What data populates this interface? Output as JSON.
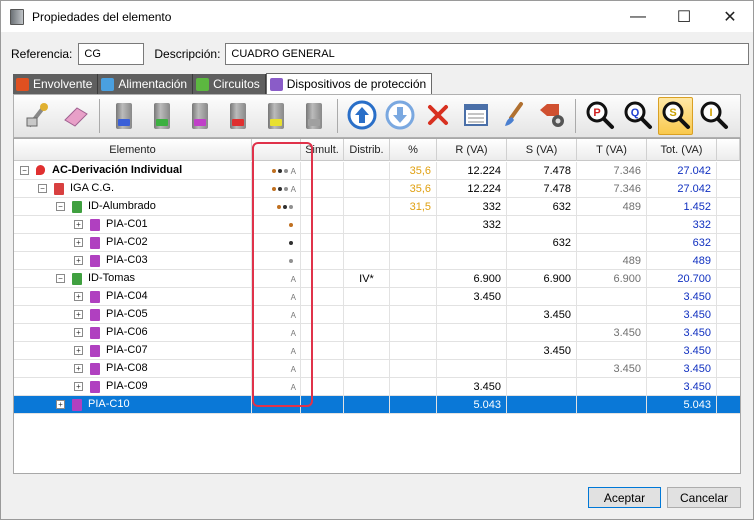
{
  "window": {
    "title": "Propiedades del elemento",
    "minimize_glyph": "—",
    "maximize_glyph": "☐",
    "close_glyph": "✕"
  },
  "fields": {
    "referencia_label": "Referencia:",
    "referencia_value": "CG",
    "descripcion_label": "Descripción:",
    "descripcion_value": "CUADRO GENERAL"
  },
  "tabs": [
    {
      "label": "Envolvente",
      "icon": "envelope-icon",
      "color": "#e05020"
    },
    {
      "label": "Alimentación",
      "icon": "feed-icon",
      "color": "#4aa0e0"
    },
    {
      "label": "Circuitos",
      "icon": "circuits-icon",
      "color": "#5cb840"
    },
    {
      "label": "Dispositivos de protección",
      "icon": "protection-devices-icon",
      "color": "#8a5cc8",
      "active": true
    }
  ],
  "toolbar_icons": [
    "wizard-icon",
    "eraser-icon",
    "device-blue-icon",
    "device-green-icon",
    "device-purple-icon",
    "device-red-icon",
    "device-yellow-icon",
    "device-grey-icon",
    "move-up-icon",
    "move-down-icon",
    "delete-icon",
    "table-view-icon",
    "brush-icon",
    "price-tag-settings-icon",
    "search-p-icon",
    "search-q-icon",
    "search-s-icon",
    "search-i-icon"
  ],
  "columns": [
    "Elemento",
    "Simult.",
    "Distrib.",
    "%",
    "R (VA)",
    "S (VA)",
    "T (VA)",
    "Tot. (VA)"
  ],
  "colors": {
    "pct": "#e0a010",
    "tot": "#1030c0",
    "t": "#707070",
    "selection": "#0a78d7",
    "highlight_box": "#e0324a"
  },
  "rows": [
    {
      "level": 0,
      "exp": "−",
      "name": "AC-Derivación Individual",
      "bold": true,
      "icon": "pin-icon",
      "ind": "A",
      "dots": [
        "#c07020",
        "#303030",
        "#909090"
      ],
      "simult": "",
      "distrib": "",
      "pct": "35,6",
      "r": "12.224",
      "s": "7.478",
      "t": "7.346",
      "tot": "27.042"
    },
    {
      "level": 1,
      "exp": "−",
      "name": "IGA C.G.",
      "bold": false,
      "icon": "breaker-red-icon",
      "ind": "A",
      "dots": [
        "#c07020",
        "#303030",
        "#909090"
      ],
      "simult": "",
      "distrib": "",
      "pct": "35,6",
      "r": "12.224",
      "s": "7.478",
      "t": "7.346",
      "tot": "27.042"
    },
    {
      "level": 2,
      "exp": "−",
      "name": "ID-Alumbrado",
      "bold": false,
      "icon": "breaker-green-icon",
      "ind": "",
      "dots": [
        "#c07020",
        "#303030",
        "#909090"
      ],
      "simult": "",
      "distrib": "",
      "pct": "31,5",
      "r": "332",
      "s": "632",
      "t": "489",
      "tot": "1.452"
    },
    {
      "level": 3,
      "exp": "+",
      "name": "PIA-C01",
      "bold": false,
      "icon": "breaker-purple-icon",
      "ind": "",
      "dots": [
        "#c07020"
      ],
      "simult": "",
      "distrib": "",
      "pct": "",
      "r": "332",
      "s": "",
      "t": "",
      "tot": "332"
    },
    {
      "level": 3,
      "exp": "+",
      "name": "PIA-C02",
      "bold": false,
      "icon": "breaker-purple-icon",
      "ind": "",
      "dots": [
        "#303030"
      ],
      "simult": "",
      "distrib": "",
      "pct": "",
      "r": "",
      "s": "632",
      "t": "",
      "tot": "632"
    },
    {
      "level": 3,
      "exp": "+",
      "name": "PIA-C03",
      "bold": false,
      "icon": "breaker-purple-icon",
      "ind": "",
      "dots": [
        "#909090"
      ],
      "simult": "",
      "distrib": "",
      "pct": "",
      "r": "",
      "s": "",
      "t": "489",
      "tot": "489"
    },
    {
      "level": 2,
      "exp": "−",
      "name": "ID-Tomas",
      "bold": false,
      "icon": "breaker-green-icon",
      "ind": "A",
      "dots": [],
      "simult": "",
      "distrib": "IV*",
      "pct": "",
      "r": "6.900",
      "s": "6.900",
      "t": "6.900",
      "tot": "20.700"
    },
    {
      "level": 3,
      "exp": "+",
      "name": "PIA-C04",
      "bold": false,
      "icon": "breaker-purple-icon",
      "ind": "A",
      "dots": [],
      "simult": "",
      "distrib": "",
      "pct": "",
      "r": "3.450",
      "s": "",
      "t": "",
      "tot": "3.450"
    },
    {
      "level": 3,
      "exp": "+",
      "name": "PIA-C05",
      "bold": false,
      "icon": "breaker-purple-icon",
      "ind": "A",
      "dots": [],
      "simult": "",
      "distrib": "",
      "pct": "",
      "r": "",
      "s": "3.450",
      "t": "",
      "tot": "3.450"
    },
    {
      "level": 3,
      "exp": "+",
      "name": "PIA-C06",
      "bold": false,
      "icon": "breaker-purple-icon",
      "ind": "A",
      "dots": [],
      "simult": "",
      "distrib": "",
      "pct": "",
      "r": "",
      "s": "",
      "t": "3.450",
      "tot": "3.450"
    },
    {
      "level": 3,
      "exp": "+",
      "name": "PIA-C07",
      "bold": false,
      "icon": "breaker-purple-icon",
      "ind": "A",
      "dots": [],
      "simult": "",
      "distrib": "",
      "pct": "",
      "r": "",
      "s": "3.450",
      "t": "",
      "tot": "3.450"
    },
    {
      "level": 3,
      "exp": "+",
      "name": "PIA-C08",
      "bold": false,
      "icon": "breaker-purple-icon",
      "ind": "A",
      "dots": [],
      "simult": "",
      "distrib": "",
      "pct": "",
      "r": "",
      "s": "",
      "t": "3.450",
      "tot": "3.450"
    },
    {
      "level": 3,
      "exp": "+",
      "name": "PIA-C09",
      "bold": false,
      "icon": "breaker-purple-icon",
      "ind": "A",
      "dots": [],
      "simult": "",
      "distrib": "",
      "pct": "",
      "r": "3.450",
      "s": "",
      "t": "",
      "tot": "3.450"
    },
    {
      "level": 2,
      "exp": "+",
      "name": "PIA-C10",
      "bold": false,
      "icon": "breaker-purple-icon",
      "ind": "",
      "dots": [],
      "simult": "",
      "distrib": "",
      "pct": "",
      "r": "5.043",
      "s": "",
      "t": "",
      "tot": "5.043",
      "selected": true
    }
  ],
  "buttons": {
    "accept": "Aceptar",
    "cancel": "Cancelar"
  }
}
